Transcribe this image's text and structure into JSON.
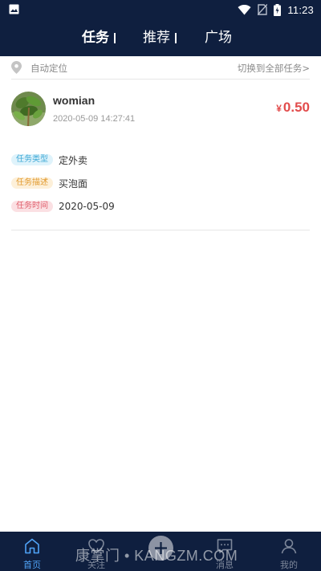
{
  "status_bar": {
    "time": "11:23",
    "icons": [
      "gallery-icon",
      "wifi-icon",
      "no-sim-icon",
      "battery-charging-icon"
    ]
  },
  "header": {
    "tabs": [
      {
        "label": "任务",
        "active": true
      },
      {
        "label": "推荐",
        "active": false
      },
      {
        "label": "广场",
        "active": false
      }
    ]
  },
  "location": {
    "label": "自动定位",
    "switch_link": "切换到全部任务>",
    "icon": "location-pin-icon"
  },
  "task": {
    "username": "womian",
    "post_time": "2020-05-09 14:27:41",
    "currency": "¥",
    "price": "0.50",
    "rows": [
      {
        "tag": "任务类型",
        "value": "定外卖"
      },
      {
        "tag": "任务描述",
        "value": "买泡面"
      },
      {
        "tag": "任务时间",
        "value": "2020-05-09"
      }
    ]
  },
  "bottom_nav": {
    "items": [
      {
        "label": "首页",
        "icon": "home-icon",
        "active": true
      },
      {
        "label": "关注",
        "icon": "heart-icon",
        "active": false
      },
      {
        "label": "",
        "icon": "plus-icon",
        "active": false
      },
      {
        "label": "消息",
        "icon": "message-icon",
        "active": false
      },
      {
        "label": "我的",
        "icon": "user-icon",
        "active": false
      }
    ]
  },
  "watermark": "康掌门 • KANGZM.COM",
  "colors": {
    "header_bg": "#0f1f3f",
    "price": "#e24c4c",
    "nav_active": "#4fa3f7"
  }
}
